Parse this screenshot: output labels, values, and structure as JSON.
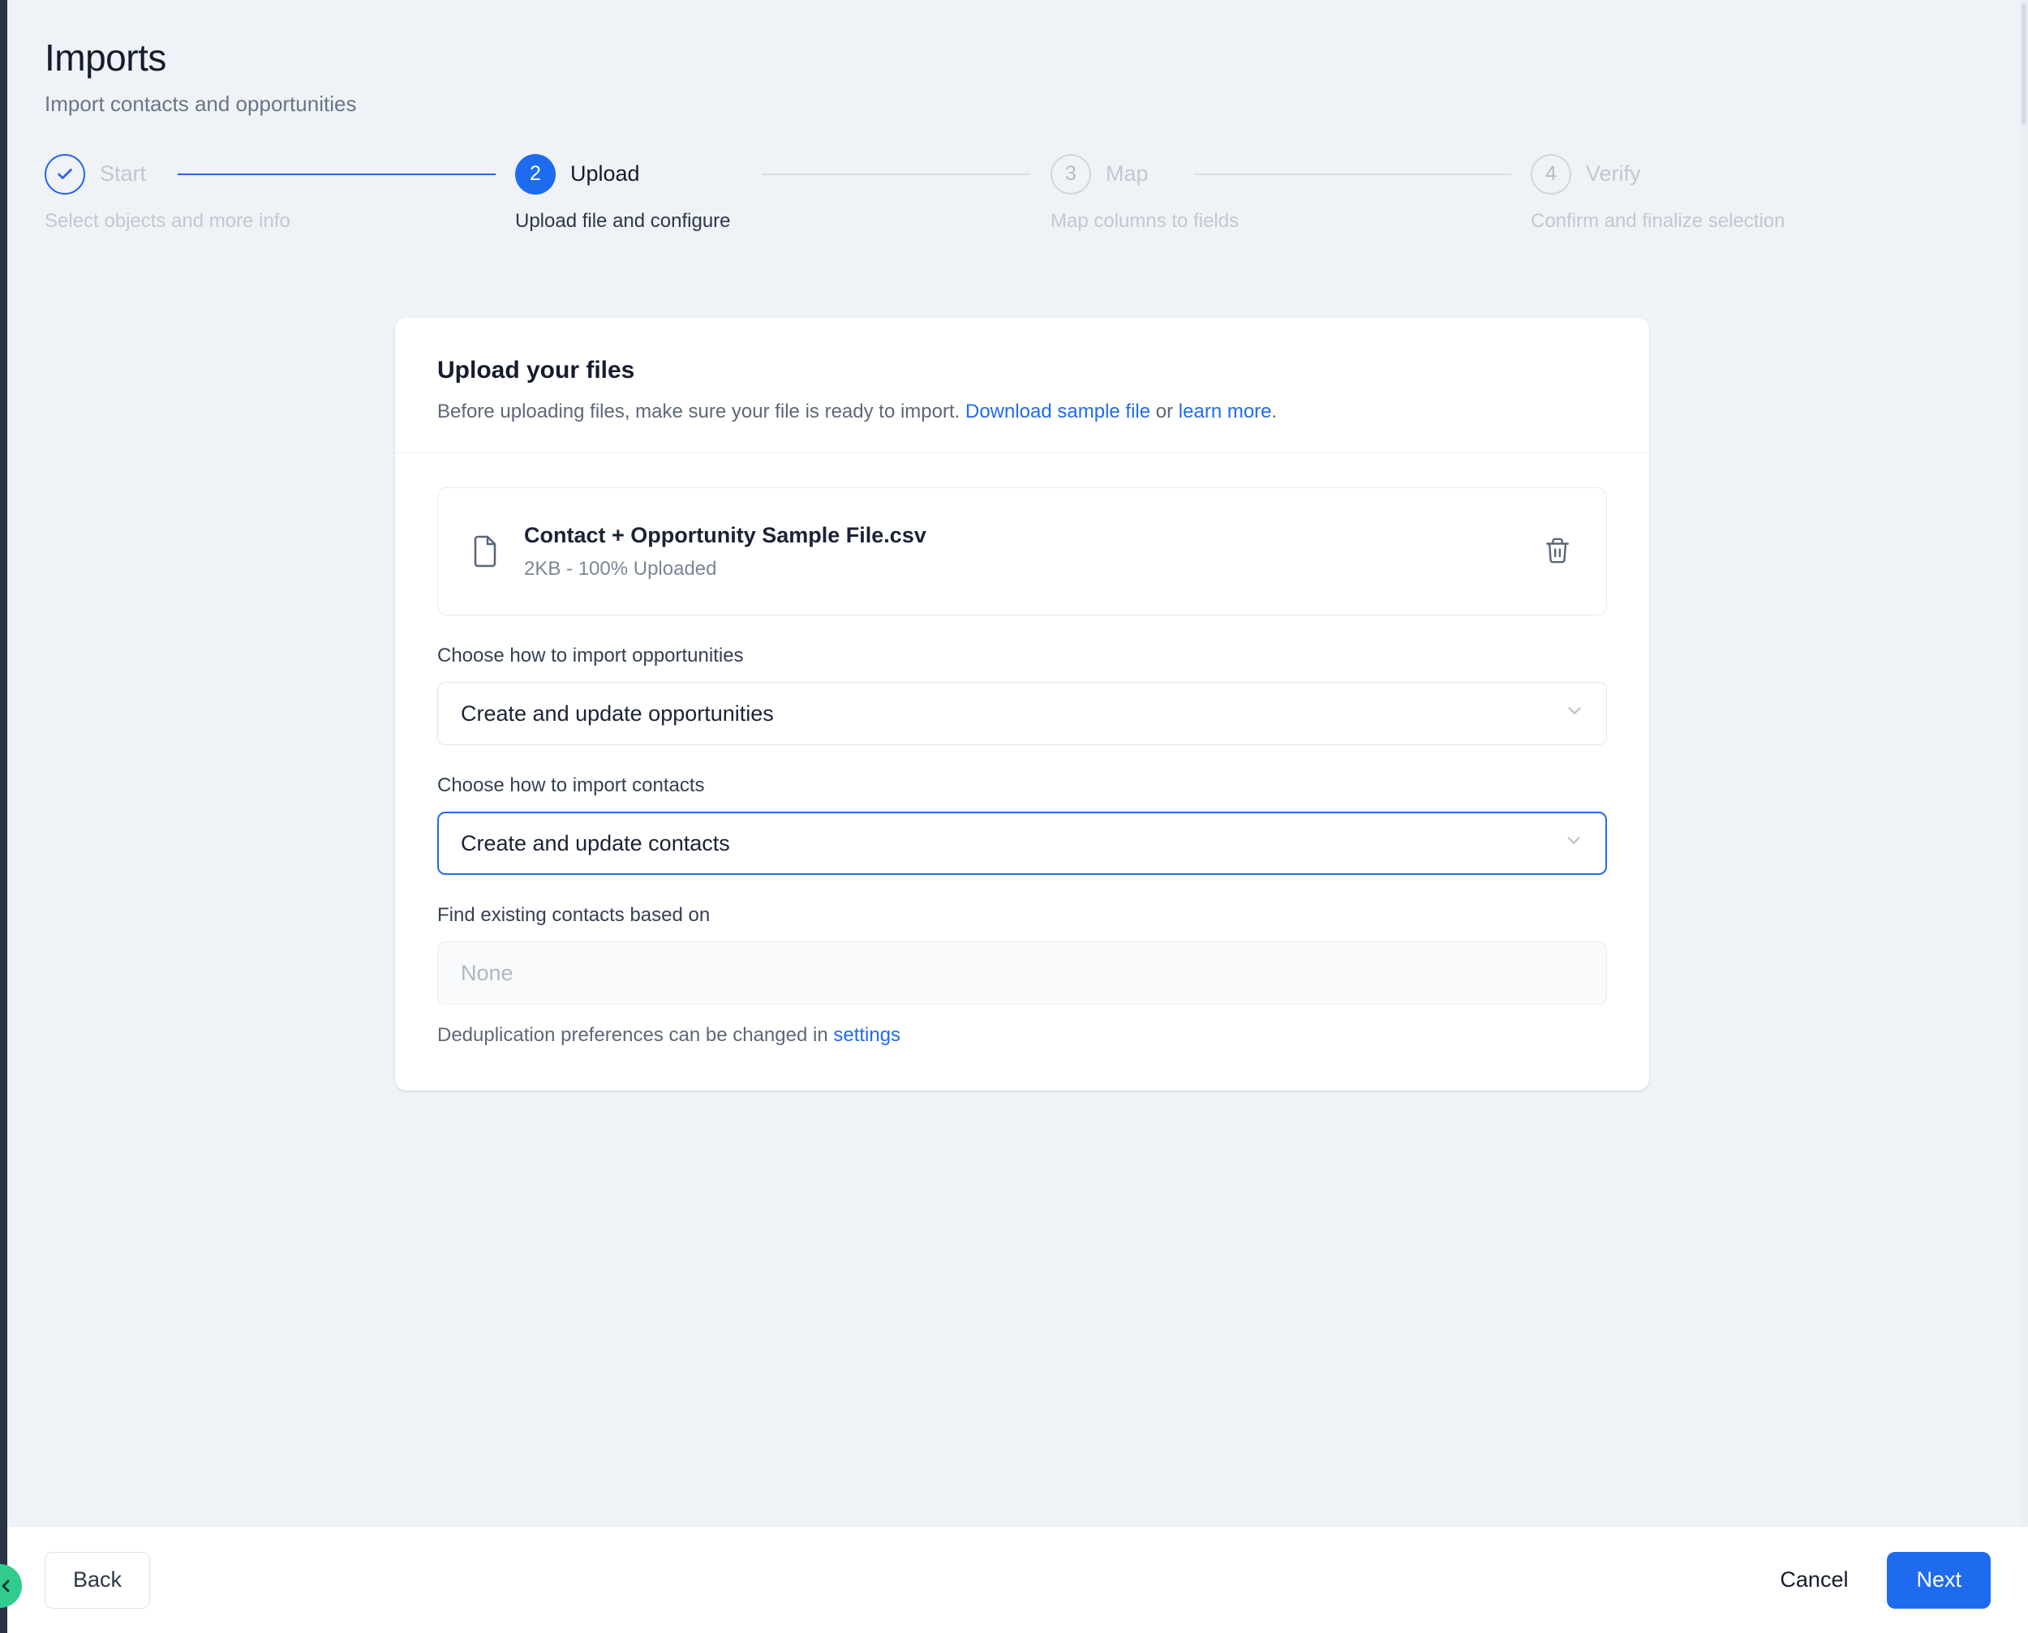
{
  "colors": {
    "accent": "#1f6bf0",
    "accent_dark": "#2563eb",
    "rail": "#2b3445",
    "toggle_green": "#31cb8f",
    "page_bg": "#eff3f7",
    "muted": "#c2c8d0"
  },
  "header": {
    "title": "Imports",
    "subtitle": "Import contacts and opportunities"
  },
  "stepper": {
    "steps": [
      {
        "number": "✓",
        "label": "Start",
        "desc": "Select objects and more info",
        "state": "done"
      },
      {
        "number": "2",
        "label": "Upload",
        "desc": "Upload file and configure",
        "state": "current"
      },
      {
        "number": "3",
        "label": "Map",
        "desc": "Map columns to fields",
        "state": "todo"
      },
      {
        "number": "4",
        "label": "Verify",
        "desc": "Confirm and finalize selection",
        "state": "todo"
      }
    ]
  },
  "card": {
    "title": "Upload your files",
    "subtitle_before": "Before uploading files, make sure your file is ready to import.",
    "link_download": "Download sample file",
    "subtitle_or": "or",
    "link_learn": "learn more",
    "subtitle_period": ".",
    "file": {
      "icon": "file-icon",
      "name": "Contact + Opportunity Sample File.csv",
      "status": "2KB - 100% Uploaded",
      "delete_icon": "trash-icon"
    },
    "fields": [
      {
        "label": "Choose how to import opportunities",
        "value": "Create and update opportunities",
        "state": "normal",
        "name": "import-opportunities-select"
      },
      {
        "label": "Choose how to import contacts",
        "value": "Create and update contacts",
        "state": "focused",
        "name": "import-contacts-select"
      },
      {
        "label": "Find existing contacts based on",
        "value": "None",
        "state": "disabled",
        "name": "find-existing-contacts-select"
      }
    ],
    "helper_before": "Deduplication preferences can be changed in",
    "helper_link": "settings"
  },
  "footer": {
    "back_label": "Back",
    "cancel_label": "Cancel",
    "next_label": "Next"
  },
  "sidebar": {
    "collapse_icon": "chevron-left-icon"
  }
}
